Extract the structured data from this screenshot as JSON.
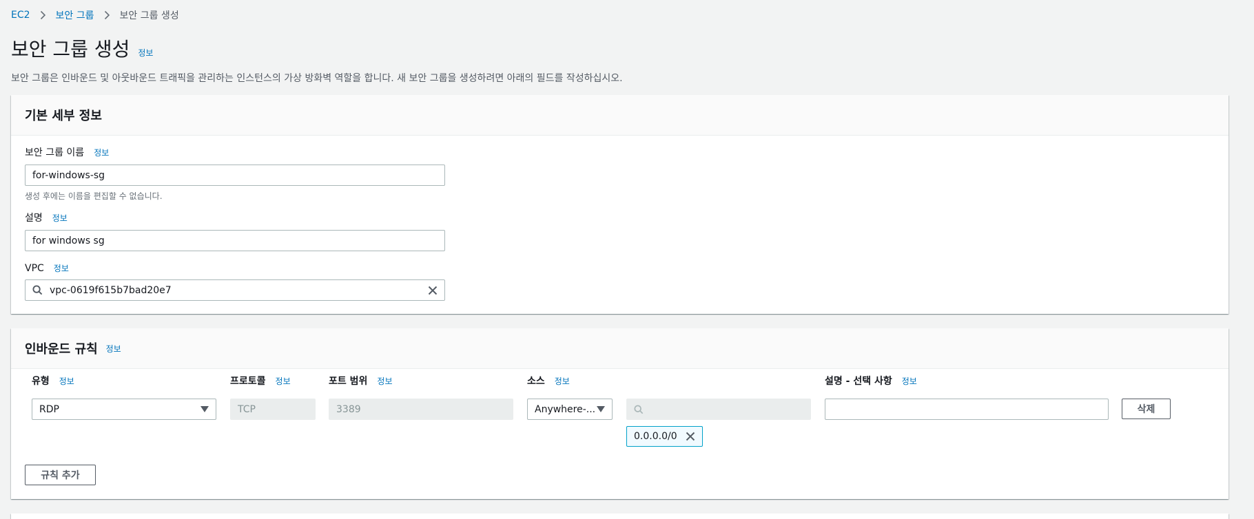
{
  "breadcrumb": {
    "items": [
      "EC2",
      "보안 그룹",
      "보안 그룹 생성"
    ]
  },
  "page": {
    "title": "보안 그룹 생성",
    "info_label": "정보",
    "description": "보안 그룹은 인바운드 및 아웃바운드 트래픽을 관리하는 인스턴스의 가상 방화벽 역할을 합니다. 새 보안 그룹을 생성하려면 아래의 필드를 작성하십시오."
  },
  "basic_details": {
    "header": "기본 세부 정보",
    "name_field": {
      "label": "보안 그룹 이름",
      "info": "정보",
      "value": "for-windows-sg",
      "hint": "생성 후에는 이름을 편집할 수 없습니다."
    },
    "description_field": {
      "label": "설명",
      "info": "정보",
      "value": "for windows sg"
    },
    "vpc_field": {
      "label": "VPC",
      "info": "정보",
      "value": "vpc-0619f615b7bad20e7",
      "icon": "search-icon",
      "clear_icon": "close-icon"
    }
  },
  "inbound_rules": {
    "header": "인바운드 규칙",
    "info": "정보",
    "columns": {
      "type": {
        "label": "유형",
        "info": "정보"
      },
      "protocol": {
        "label": "프로토콜",
        "info": "정보"
      },
      "port_range": {
        "label": "포트 범위",
        "info": "정보"
      },
      "source": {
        "label": "소스",
        "info": "정보"
      },
      "description": {
        "label": "설명 - 선택 사항",
        "info": "정보"
      }
    },
    "rules": [
      {
        "type": "RDP",
        "protocol": "TCP",
        "port_range": "3389",
        "source_select": "Anywhere-...",
        "source_search": "",
        "cidr_token": "0.0.0.0/0",
        "description": "",
        "delete_label": "삭제"
      }
    ],
    "add_rule_label": "규칙 추가"
  },
  "colors": {
    "background": "#f2f3f3",
    "link": "#0073bb",
    "token_border": "#00a1c9",
    "disabled_bg": "#eaeded"
  }
}
